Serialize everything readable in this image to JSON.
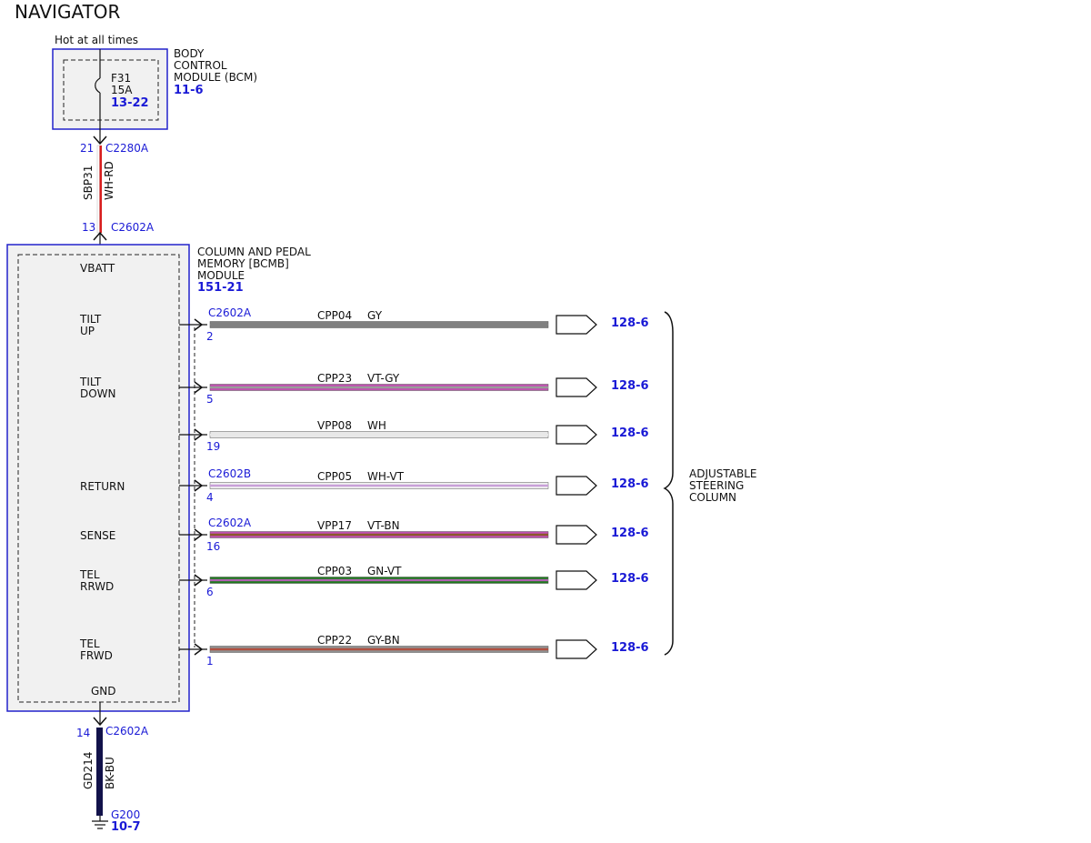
{
  "title": "NAVIGATOR",
  "power": {
    "label": "Hot at all times"
  },
  "bcm": {
    "fuse_id": "F31",
    "fuse_rating": "15A",
    "fuse_ref": "13-22",
    "name_lines": [
      "BODY",
      "CONTROL",
      "MODULE (BCM)"
    ],
    "ref": "11-6"
  },
  "feed": {
    "top_pin": "21",
    "top_connector": "C2280A",
    "circuit": "SBP31",
    "color": "WH-RD",
    "bottom_pin": "13",
    "bottom_connector": "C2602A"
  },
  "module": {
    "name_lines": [
      "COLUMN AND PEDAL",
      "MEMORY [BCMB]",
      "MODULE"
    ],
    "ref": "151-21",
    "vbatt": "VBATT",
    "gnd": "GND"
  },
  "wires": [
    {
      "pin_lines": [
        "TILT",
        "UP"
      ],
      "connector": "C2602A",
      "pin": "2",
      "circuit": "CPP04",
      "color": "GY",
      "dest": "128-6",
      "colors": [
        "#808080",
        "#808080"
      ]
    },
    {
      "pin_lines": [
        "TILT",
        "DOWN"
      ],
      "connector": "",
      "pin": "5",
      "circuit": "CPP23",
      "color": "VT-GY",
      "dest": "128-6",
      "colors": [
        "#c050b0",
        "#9a9a9a"
      ]
    },
    {
      "pin_lines": [
        "",
        ""
      ],
      "connector": "",
      "pin": "19",
      "circuit": "VPP08",
      "color": "WH",
      "dest": "128-6",
      "colors": [
        "#e8e8e8",
        "#e8e8e8"
      ]
    },
    {
      "pin_lines": [
        "RETURN",
        ""
      ],
      "connector": "C2602B",
      "pin": "4",
      "circuit": "CPP05",
      "color": "WH-VT",
      "dest": "128-6",
      "colors": [
        "#f0f0f0",
        "#c9a0d8"
      ]
    },
    {
      "pin_lines": [
        "SENSE",
        ""
      ],
      "connector": "C2602A",
      "pin": "16",
      "circuit": "VPP17",
      "color": "VT-BN",
      "dest": "128-6",
      "colors": [
        "#c050b0",
        "#8b5a2b"
      ]
    },
    {
      "pin_lines": [
        "TEL",
        "RRWD"
      ],
      "connector": "",
      "pin": "6",
      "circuit": "CPP03",
      "color": "GN-VT",
      "dest": "128-6",
      "colors": [
        "#1e7a1e",
        "#b060b0"
      ]
    },
    {
      "pin_lines": [
        "TEL",
        "FRWD"
      ],
      "connector": "",
      "pin": "1",
      "circuit": "CPP22",
      "color": "GY-BN",
      "dest": "128-6",
      "colors": [
        "#909090",
        "#b05040"
      ]
    }
  ],
  "column": {
    "name_lines": [
      "ADJUSTABLE",
      "STEERING",
      "COLUMN"
    ]
  },
  "ground": {
    "pin": "14",
    "connector": "C2602A",
    "circuit": "GD214",
    "color": "BK-BU",
    "point": "G200",
    "ref": "10-7"
  }
}
